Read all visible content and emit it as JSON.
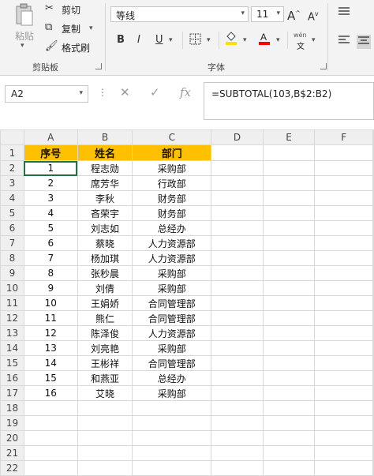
{
  "ribbon": {
    "clipboard": {
      "paste_label": "粘贴",
      "cut_label": "剪切",
      "copy_label": "复制",
      "format_painter_label": "格式刷",
      "group_label": "剪贴板"
    },
    "font": {
      "font_name": "等线",
      "font_size": "11",
      "phonetic_top": "wén",
      "phonetic_bottom": "文",
      "group_label": "字体",
      "fill_color": "#ffe000",
      "font_color": "#ff0000"
    }
  },
  "formula_bar": {
    "name_box": "A2",
    "formula": "=SUBTOTAL(103,B$2:B2)"
  },
  "sheet": {
    "columns": [
      "A",
      "B",
      "C",
      "D",
      "E",
      "F"
    ],
    "header": [
      "序号",
      "姓名",
      "部门"
    ],
    "rows": [
      [
        "1",
        "程志勋",
        "采购部"
      ],
      [
        "2",
        "席芳华",
        "行政部"
      ],
      [
        "3",
        "李秋",
        "财务部"
      ],
      [
        "4",
        "吝荣宇",
        "财务部"
      ],
      [
        "5",
        "刘志如",
        "总经办"
      ],
      [
        "6",
        "蔡晓",
        "人力资源部"
      ],
      [
        "7",
        "杨加琪",
        "人力资源部"
      ],
      [
        "8",
        "张秒晨",
        "采购部"
      ],
      [
        "9",
        "刘倩",
        "采购部"
      ],
      [
        "10",
        "王娟娇",
        "合同管理部"
      ],
      [
        "11",
        "熊仁",
        "合同管理部"
      ],
      [
        "12",
        "陈泽俊",
        "人力资源部"
      ],
      [
        "13",
        "刘亮艳",
        "采购部"
      ],
      [
        "14",
        "王彬祥",
        "合同管理部"
      ],
      [
        "15",
        "和燕亚",
        "总经办"
      ],
      [
        "16",
        "艾晓",
        "采购部"
      ],
      [
        "",
        "",
        ""
      ],
      [
        "",
        "",
        ""
      ],
      [
        "",
        "",
        ""
      ],
      [
        "",
        "",
        ""
      ],
      [
        "",
        "",
        ""
      ]
    ],
    "header_color": "#ffc000"
  }
}
